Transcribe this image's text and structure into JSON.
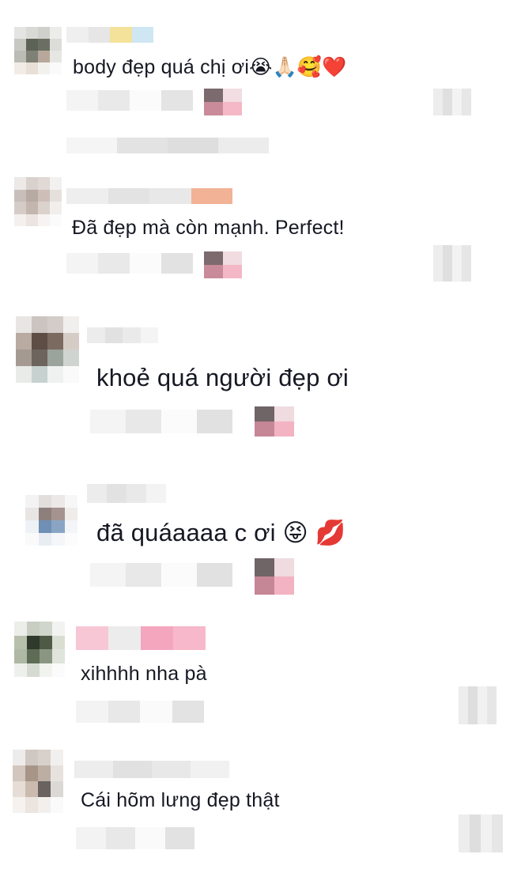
{
  "comments": [
    {
      "text": "body đẹp quá chị ơi😭🙏🏻🥰❤️",
      "emoji_names": [
        "loudly-crying-face",
        "folded-hands",
        "smiling-face-with-hearts",
        "red-heart"
      ]
    },
    {
      "text": "Đã đẹp mà còn mạnh. Perfect!"
    },
    {
      "text": "khoẻ quá người đẹp ơi"
    },
    {
      "text": "đã quáaaaa c ơi 😝 💋",
      "emoji_names": [
        "squinting-face-with-tongue",
        "kiss-mark"
      ]
    },
    {
      "text": "xihhhh nha pà"
    },
    {
      "text": "Cái hõm lưng đẹp thật"
    }
  ],
  "colors": {
    "text": "#161823",
    "pixel_gray_light": "#ececec",
    "pixel_gray": "#dcdcdc",
    "pixel_pink": "#f3b9c8",
    "pixel_dark": "#6d6163"
  }
}
